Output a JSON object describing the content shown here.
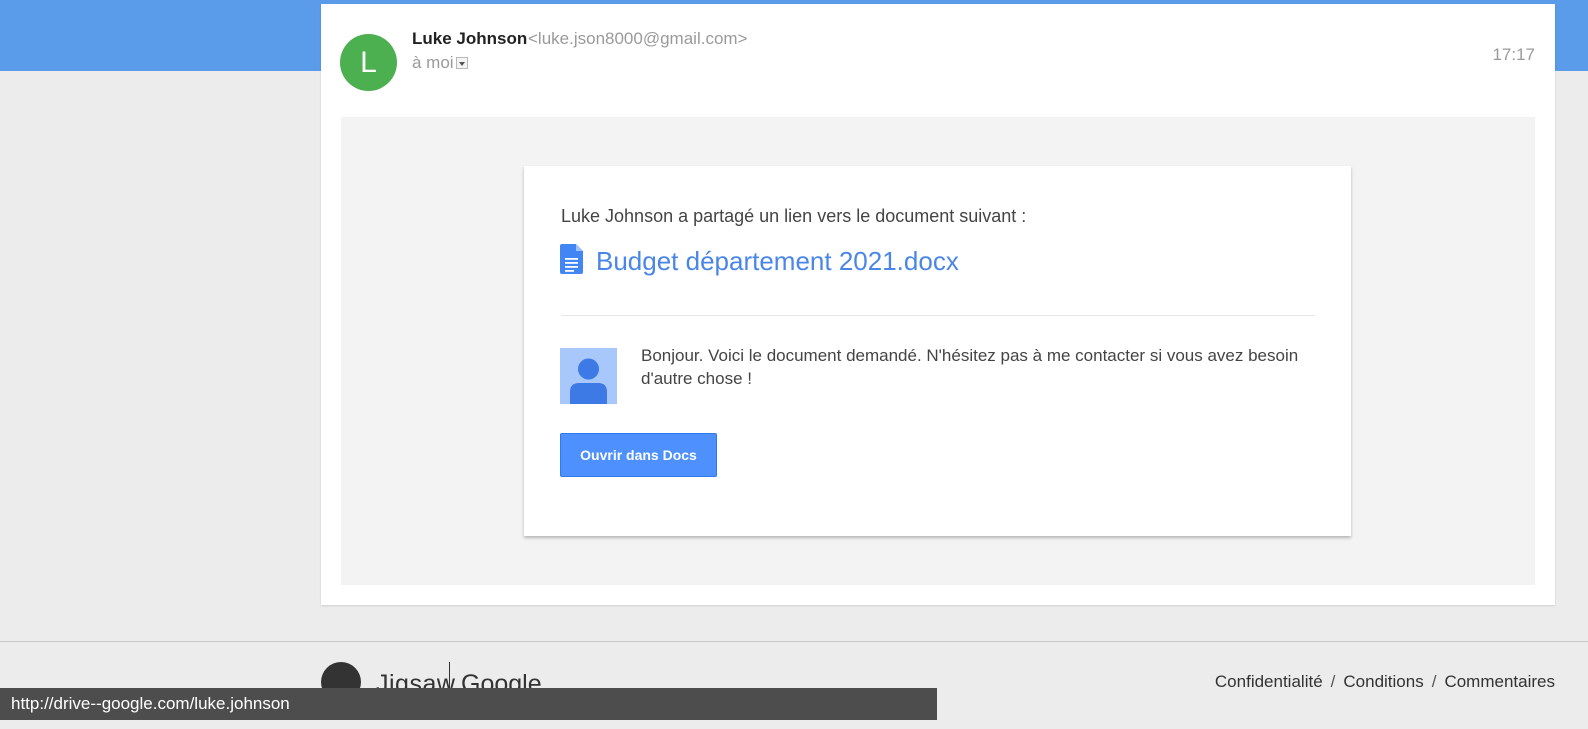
{
  "header": {
    "sender_initial": "L",
    "sender_name": "Luke Johnson",
    "sender_email": "<luke.json8000@gmail.com>",
    "recipient": "à moi",
    "time": "17:17"
  },
  "share": {
    "intro": "Luke Johnson a partagé un lien vers le document suivant :",
    "document_name": "Budget département 2021.docx",
    "message": "Bonjour. Voici le document demandé. N'hésitez pas à me contacter si vous avez besoin d'autre chose !",
    "open_button_label": "Ouvrir dans Docs"
  },
  "footer": {
    "logo_text": "Jigsaw",
    "logo_partner": "Google",
    "links": [
      "Confidentialité",
      "Conditions",
      "Commentaires"
    ]
  },
  "status_bar": {
    "url": "http://drive--google.com/luke.johnson"
  },
  "colors": {
    "topbar": "#5a9bea",
    "avatar": "#4caf50",
    "link": "#4a86e8",
    "button": "#4d90fe"
  },
  "icons": {
    "document": "google-docs-icon",
    "sharer_photo": "default-user-avatar-icon",
    "recipient_dropdown": "chevron-down-icon"
  }
}
